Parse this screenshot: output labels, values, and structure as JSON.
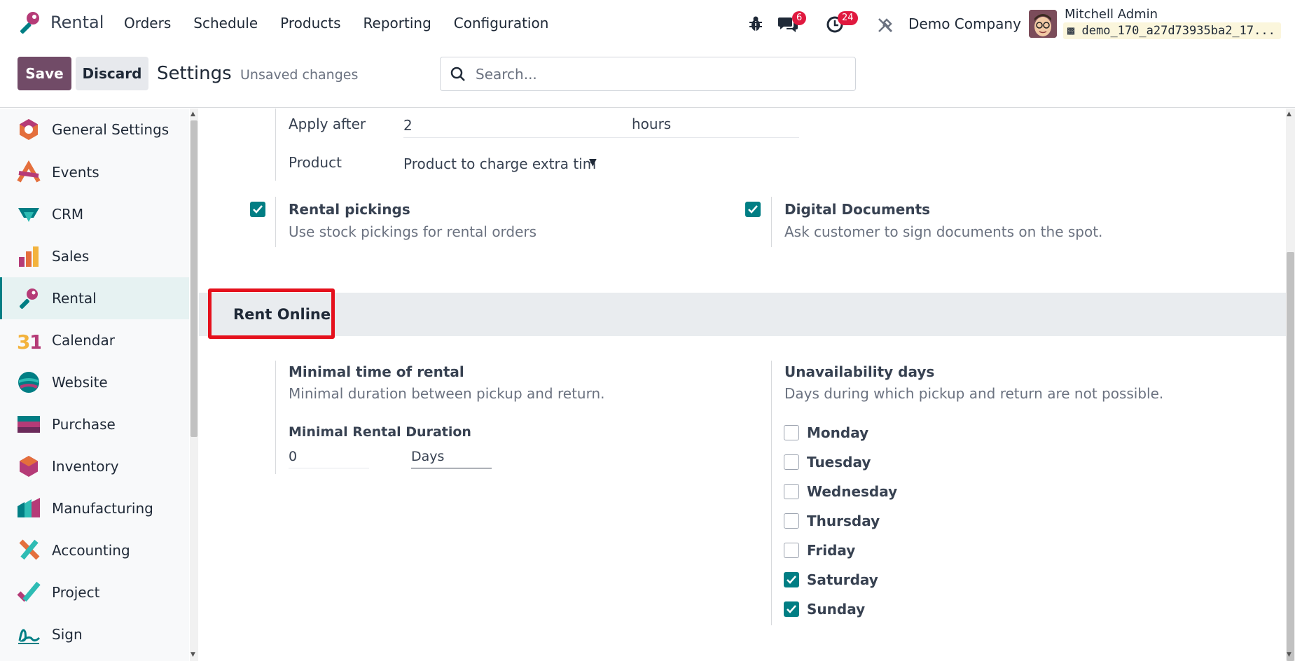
{
  "nav": {
    "app_name": "Rental",
    "menu": [
      "Orders",
      "Schedule",
      "Products",
      "Reporting",
      "Configuration"
    ],
    "messages_count": "6",
    "activities_count": "24",
    "company": "Demo Company",
    "user_name": "Mitchell Admin",
    "db_name": "demo_170_a27d73935ba2_17..."
  },
  "control": {
    "save_label": "Save",
    "discard_label": "Discard",
    "title": "Settings",
    "status": "Unsaved changes",
    "search_placeholder": "Search..."
  },
  "sidebar": {
    "items": [
      {
        "label": "General Settings",
        "icon": "general-settings-icon"
      },
      {
        "label": "Events",
        "icon": "events-icon"
      },
      {
        "label": "CRM",
        "icon": "crm-icon"
      },
      {
        "label": "Sales",
        "icon": "sales-icon"
      },
      {
        "label": "Rental",
        "icon": "rental-icon",
        "active": true
      },
      {
        "label": "Calendar",
        "icon": "calendar-icon"
      },
      {
        "label": "Website",
        "icon": "website-icon"
      },
      {
        "label": "Purchase",
        "icon": "purchase-icon"
      },
      {
        "label": "Inventory",
        "icon": "inventory-icon"
      },
      {
        "label": "Manufacturing",
        "icon": "manufacturing-icon"
      },
      {
        "label": "Accounting",
        "icon": "accounting-icon"
      },
      {
        "label": "Project",
        "icon": "project-icon"
      },
      {
        "label": "Sign",
        "icon": "sign-icon"
      }
    ]
  },
  "delay": {
    "apply_after_label": "Apply after",
    "apply_after_value": "2",
    "apply_after_unit": "hours",
    "product_label": "Product",
    "product_value": "Product to charge extra tim"
  },
  "rental_pickings": {
    "title": "Rental pickings",
    "description": "Use stock pickings for rental orders",
    "checked": true
  },
  "digital_documents": {
    "title": "Digital Documents",
    "description": "Ask customer to sign documents on the spot.",
    "checked": true
  },
  "rent_online": {
    "section_title": "Rent Online",
    "min_time_title": "Minimal time of rental",
    "min_time_desc": "Minimal duration between pickup and return.",
    "min_duration_label": "Minimal Rental Duration",
    "min_duration_value": "0",
    "min_duration_unit": "Days",
    "unavail_title": "Unavailability days",
    "unavail_desc": "Days during which pickup and return are not possible.",
    "days": [
      {
        "label": "Monday",
        "checked": false
      },
      {
        "label": "Tuesday",
        "checked": false
      },
      {
        "label": "Wednesday",
        "checked": false
      },
      {
        "label": "Thursday",
        "checked": false
      },
      {
        "label": "Friday",
        "checked": false
      },
      {
        "label": "Saturday",
        "checked": true
      },
      {
        "label": "Sunday",
        "checked": true
      }
    ]
  },
  "colors": {
    "brand": "#714b67",
    "accent": "#017e84",
    "badge": "#e0193f",
    "highlight": "#e5101c"
  }
}
